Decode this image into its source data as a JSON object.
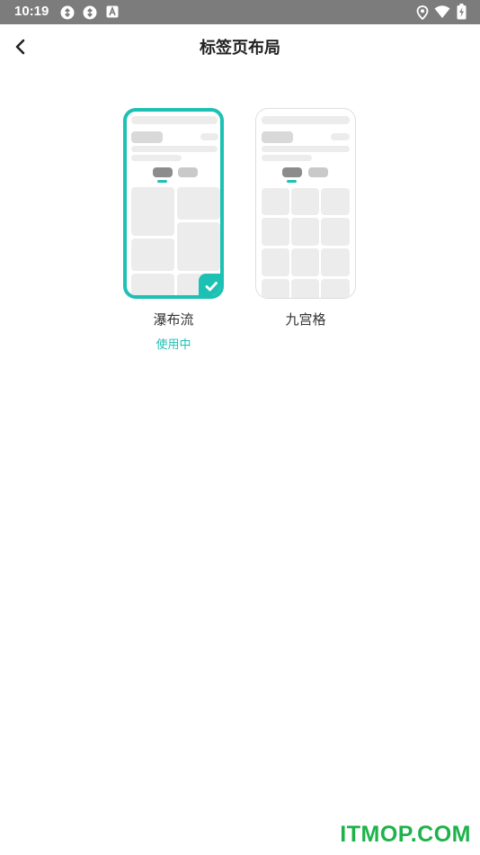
{
  "status_bar": {
    "time": "10:19"
  },
  "header": {
    "title": "标签页布局"
  },
  "layouts": [
    {
      "label": "瀑布流",
      "status": "使用中",
      "selected": true
    },
    {
      "label": "九宫格",
      "selected": false
    }
  ],
  "colors": {
    "accent": "#1dc1b4",
    "status_bar": "#7c7c7c",
    "watermark": "#1db34a"
  },
  "watermark": "ITMOP.COM"
}
